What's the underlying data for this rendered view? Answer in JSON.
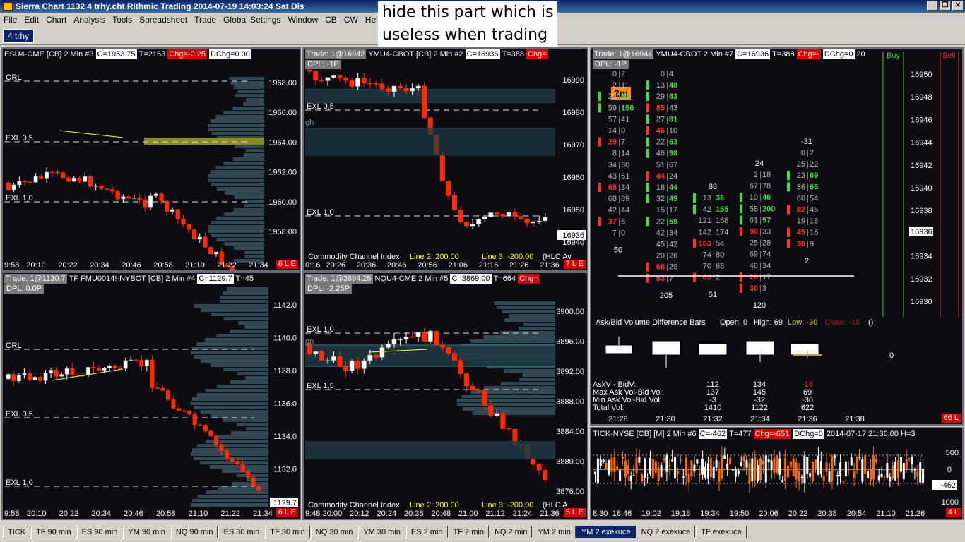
{
  "window": {
    "title": "Sierra Chart 1132 4 trhy.cht  Rithmic Trading 2014-07-19  14:03:24 Sat  Dis"
  },
  "menu": [
    "File",
    "Edit",
    "Chart",
    "Analysis",
    "Tools",
    "Spreadsheet",
    "Trade",
    "Global Settings",
    "Window",
    "CB",
    "CW",
    "Help"
  ],
  "annotation": {
    "line1": "hide this part which is",
    "line2": "useless when trading"
  },
  "top_tab": "4 trhy",
  "charts": {
    "es": {
      "sym": "ESU4-CME [CB]  2 Min",
      "num": "#3",
      "c": "C=1953.75",
      "t": "T=2153",
      "chg": "Chg=-0.25",
      "dchg": "DChg=0.00",
      "yticks": [
        "1968.00",
        "1966.00",
        "1964.00",
        "1962.00",
        "1960.00",
        "1958.00"
      ],
      "xticks": [
        "9:58",
        "20:10",
        "20:22",
        "20:34",
        "20:46",
        "20:58",
        "21:10",
        "21:22",
        "21:34"
      ],
      "levels": [
        "ORL",
        "EXL 0,5",
        "EXL 1,0"
      ],
      "badge": "6 L E"
    },
    "ym": {
      "trade": "Trade: 1@16942",
      "sym": "YMU4-CBOT [CB]  2 Min",
      "num": "#2",
      "c": "C=16936",
      "t": "T=388",
      "chg": "Chg=",
      "dpl": "DPL: -1P",
      "yticks": [
        "16990",
        "16980",
        "16970",
        "16960",
        "16950",
        "16940"
      ],
      "price_label": "16936",
      "xticks": [
        "0:16",
        "20:26",
        "20:36",
        "20:46",
        "20:56",
        "21:06",
        "21:16",
        "21:26",
        "21:36"
      ],
      "levels": [
        "EXL 0,5",
        "EXL 1,0"
      ],
      "gh": "gh",
      "cci": "Commodity Channel Index",
      "cci_l2": "Line 2: 200.00",
      "cci_l3": "Line 3: -200.00",
      "cci_hlc": "(HLC Av",
      "badge": "7 L E"
    },
    "tf": {
      "trade": "Trade: 1@1130.7",
      "sym": "TF  FMU0014!-NYBOT [CB]  2 Min",
      "num": "#4",
      "c": "C=1129.7",
      "t": "T=45",
      "dpl": "DPL: 0.0P",
      "yticks": [
        "1142.0",
        "1140.0",
        "1138.0",
        "1136.0",
        "1134.0",
        "1132.0",
        "1130.0"
      ],
      "price_label": "1129.7",
      "xticks": [
        "9:58",
        "20:10",
        "20:22",
        "20:34",
        "20:46",
        "20:58",
        "21:10",
        "21:22",
        "21:34"
      ],
      "levels": [
        "ORL",
        "EXL 0,5",
        "EXL 1,0"
      ],
      "badge": "6 L E"
    },
    "nq": {
      "trade": "Trade: 1@3894.25",
      "sym": "NQU4-CME  2 Min",
      "num": "#5",
      "c": "C=3869.00",
      "t": "T=664",
      "chg": "Chg=",
      "dpl": "DPL: -2.25P",
      "yticks": [
        "3900.00",
        "3896.00",
        "3892.00",
        "3888.00",
        "3884.00",
        "3880.00",
        "3876.00"
      ],
      "xticks": [
        "9:48",
        "20:00",
        "20:12",
        "20:24",
        "20:36",
        "20:48",
        "21:00",
        "21:12",
        "21:24",
        "21:36"
      ],
      "levels": [
        "EXL 1,0",
        "EXL 1,5"
      ],
      "gn": "gn",
      "cci": "Commodity Channel Index",
      "cci_l2": "Line 2: 200.00",
      "cci_l3": "Line 3: -200.00",
      "cci_hlc": "(HLC A",
      "badge": "5 L E"
    },
    "ymdom": {
      "trade": "Trade: 1@16944",
      "sym": "YMU4-CBOT  2 Min",
      "num": "#7",
      "c": "C=16936",
      "t": "T=388",
      "chg": "Chg=-",
      "dchg": "DChg=0",
      "extra": "20",
      "buy": "Buy",
      "sell": "Sell",
      "dpl": "DPL: -1P",
      "tf_badge": "2m",
      "yticks": [
        "16950",
        "16948",
        "16946",
        "16944",
        "16942",
        "16940",
        "16938",
        "16936",
        "16934",
        "16932",
        "16930"
      ],
      "price_label": "16936",
      "xticks": [
        "21:28",
        "21:30",
        "21:32",
        "21:34",
        "21:36",
        "21:38"
      ],
      "study_title": "Ask/Bid Volume Difference Bars",
      "open": "Open: 0",
      "high": "High: 69",
      "low": "Low: -30",
      "close": "Close: -18",
      "paren": "()",
      "zero": "0",
      "stats_labels": [
        "AskV - BidV:",
        "Max Ask Vol-Bid Vol:",
        "Min Ask Vol-Bid Vol:",
        "Total Vol:"
      ],
      "stats_cols": [
        [
          "112",
          "137",
          "-3",
          "1410"
        ],
        [
          "134",
          "145",
          "-32",
          "1122"
        ],
        [
          "-18",
          "69",
          "-30",
          "622"
        ]
      ],
      "badge": "66 L",
      "col1": [
        [
          "0",
          "2"
        ],
        [
          "2",
          "11"
        ],
        [
          "23",
          "81"
        ],
        [
          "59",
          "156"
        ],
        [
          "57",
          "41"
        ],
        [
          "14",
          "0"
        ],
        [
          "29",
          "7"
        ],
        [
          "8",
          "14"
        ],
        [
          "34",
          "30"
        ],
        [
          "43",
          "51"
        ],
        [
          "65",
          "34"
        ],
        [
          "68",
          "89"
        ],
        [
          "42",
          "44"
        ],
        [
          "37",
          "6"
        ],
        [
          "7",
          "0"
        ]
      ],
      "col1_b": "50",
      "col2": [
        [
          "0",
          "4"
        ],
        [
          "13",
          "48"
        ],
        [
          "29",
          "63"
        ],
        [
          "85",
          "43"
        ],
        [
          "27",
          "81"
        ],
        [
          "46",
          "10"
        ],
        [
          "22",
          "63"
        ],
        [
          "46",
          "98"
        ],
        [
          "51",
          "67"
        ],
        [
          "44",
          "24"
        ],
        [
          "18",
          "44"
        ],
        [
          "32",
          "49"
        ],
        [
          "15",
          "17"
        ],
        [
          "22",
          "58"
        ],
        [
          "42",
          "34"
        ],
        [
          "45",
          "42"
        ],
        [
          "20",
          "26"
        ],
        [
          "68",
          "29"
        ],
        [
          "53",
          "7"
        ]
      ],
      "col2_b": "205",
      "col3": [
        [
          "13",
          "36"
        ],
        [
          "42",
          "155"
        ],
        [
          "121",
          "168"
        ],
        [
          "142",
          "174"
        ],
        [
          "103",
          "54"
        ],
        [
          "74",
          "80"
        ],
        [
          "70",
          "68"
        ],
        [
          "63",
          "2"
        ]
      ],
      "col3_t": "88",
      "col3_b": "51",
      "col4": [
        [
          "2",
          "18"
        ],
        [
          "67",
          "78"
        ],
        [
          "10",
          "46"
        ],
        [
          "58",
          "200"
        ],
        [
          "61",
          "97"
        ],
        [
          "98",
          "33"
        ],
        [
          "25",
          "28"
        ],
        [
          "69",
          "74"
        ],
        [
          "46",
          "34"
        ],
        [
          "28",
          "17"
        ],
        [
          "30",
          "3"
        ]
      ],
      "col4_t": "24",
      "col4_b": "120",
      "col5": [
        [
          "0",
          "2"
        ],
        [
          "25",
          "22"
        ],
        [
          "23",
          "69"
        ],
        [
          "36",
          "65"
        ],
        [
          "60",
          "54"
        ],
        [
          "82",
          "45"
        ],
        [
          "19",
          "18"
        ],
        [
          "45",
          "18"
        ],
        [
          "30",
          "9"
        ]
      ],
      "col5_t": "-31",
      "col5_b": "2"
    },
    "tick": {
      "sym": "TICK-NYSE [CB] [M]  2 Min",
      "num": "#6",
      "c": "C=-462",
      "t": "T=477",
      "chg": "Chg=-651",
      "dchg": "DChg=0",
      "extra": "2014-07-17  21:36:00 H=3",
      "yticks": [
        "500",
        "0",
        "-462",
        "1000"
      ],
      "xticks": [
        "8:30",
        "18:46",
        "19:02",
        "19:18",
        "19:34",
        "19:50",
        "20:06",
        "20:22",
        "20:38",
        "20:54",
        "21:10",
        "21:26"
      ],
      "badge": "4 L"
    }
  },
  "bottom_tabs": [
    "TICK",
    "TF 90 min",
    "ES 90 min",
    "YM 90 min",
    "NQ 90 min",
    "ES 30 min",
    "TF 30 min",
    "NQ 30 min",
    "YM 30 min",
    "ES 2 min",
    "TF 2 min",
    "NQ 2 min",
    "YM 2 min",
    "YM 2 exekuce",
    "NQ 2 exekuce",
    "TF exekuce"
  ],
  "active_bottom_tab": "YM 2 exekuce",
  "colors": {
    "up": "#ffffff",
    "down": "#ff2a00",
    "profile": "#2f4a55",
    "bg": "#0c0c12",
    "bid": "#ff3030",
    "ask": "#40e040"
  }
}
